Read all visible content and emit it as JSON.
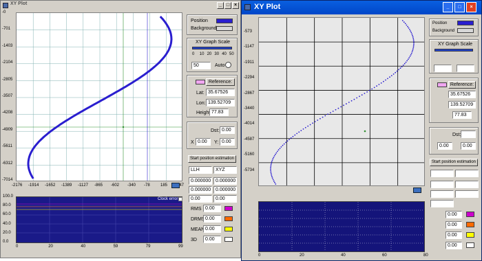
{
  "left": {
    "title": "XY Plot",
    "buttons": {
      "min": "_",
      "max": "□",
      "close": "×"
    },
    "y_ticks": [
      "-0",
      "-701",
      "-1403",
      "-2104",
      "-2805",
      "-3507",
      "-4208",
      "-4909",
      "-5611",
      "-6312",
      "-7014"
    ],
    "x_ticks": [
      "-2176",
      "-1914",
      "-1652",
      "-1389",
      "-1127",
      "-865",
      "-602",
      "-340",
      "-78",
      "185",
      "447"
    ],
    "legend": {
      "position_label": "Position",
      "position_color": "#2a1ecf",
      "background_label": "Background",
      "background_color": "#d8d8d8"
    },
    "scale": {
      "title": "XY Graph Scale",
      "ticks": [
        "0",
        "10",
        "20",
        "30",
        "40",
        "50"
      ],
      "value": "50",
      "auto_label": "Auto"
    },
    "reference": {
      "button": "Reference:",
      "lat_label": "Lat:",
      "lat": "35.67526",
      "lon_label": "Lon:",
      "lon": "139.52709",
      "height_label": "Height:",
      "height": "77.83"
    },
    "dist": {
      "label": "Dst:",
      "value": "0.00",
      "x_label": "X",
      "x": "0.00",
      "y_label": "Y:",
      "y": "0.00"
    },
    "estimate_button": "Start position estimation",
    "coords": {
      "llh": "LLH",
      "xyz": "XYZ",
      "rows": [
        [
          "0.000000",
          "0.000000"
        ],
        [
          "0.000000",
          "0.000000"
        ],
        [
          "0.00",
          "0.00"
        ]
      ]
    },
    "stats": [
      {
        "label": "RMS",
        "value": "0.00",
        "color": "#cc00cc"
      },
      {
        "label": "DRMS",
        "value": "0.00",
        "color": "#ff6a00"
      },
      {
        "label": "MEAN",
        "value": "0.00",
        "color": "#ffff00"
      },
      {
        "label": "3D",
        "value": "0.00",
        "color": "#ffffff"
      }
    ],
    "bottom_y_ticks": [
      "100.0",
      "80.0",
      "60.0",
      "40.0",
      "20.0",
      "0.0"
    ],
    "bottom_x_ticks": [
      "0",
      "20",
      "40",
      "59",
      "79",
      "99"
    ],
    "clock_error": "Clock error"
  },
  "right": {
    "title": "XY Plot",
    "buttons": {
      "min": "_",
      "max": "□",
      "close": "×"
    },
    "y_ticks": [
      "-573",
      "-1147",
      "-1911",
      "-2294",
      "-2867",
      "-3440",
      "-4014",
      "-4587",
      "-5160",
      "-5734"
    ],
    "legend": {
      "position_label": "Position",
      "background_label": "Background"
    },
    "scale": {
      "title": "XY Graph Scale"
    },
    "reference": {
      "button": "Reference:",
      "lat": "35.67526",
      "lon": "139.52709",
      "height": "77.83"
    },
    "dist": {
      "label": "Dst:",
      "x": "0.00",
      "y": "0.00"
    },
    "estimate_button": "Start position estimation",
    "stats": [
      "0.00",
      "0.00",
      "0.00",
      "0.00"
    ],
    "bottom_x_ticks": [
      "0",
      "20",
      "40",
      "60",
      "80"
    ]
  },
  "colors": {
    "track": "#2a1ecf",
    "grid": "#000000",
    "grid_light": "#9bb",
    "crosshair": "#2f8f2f"
  }
}
